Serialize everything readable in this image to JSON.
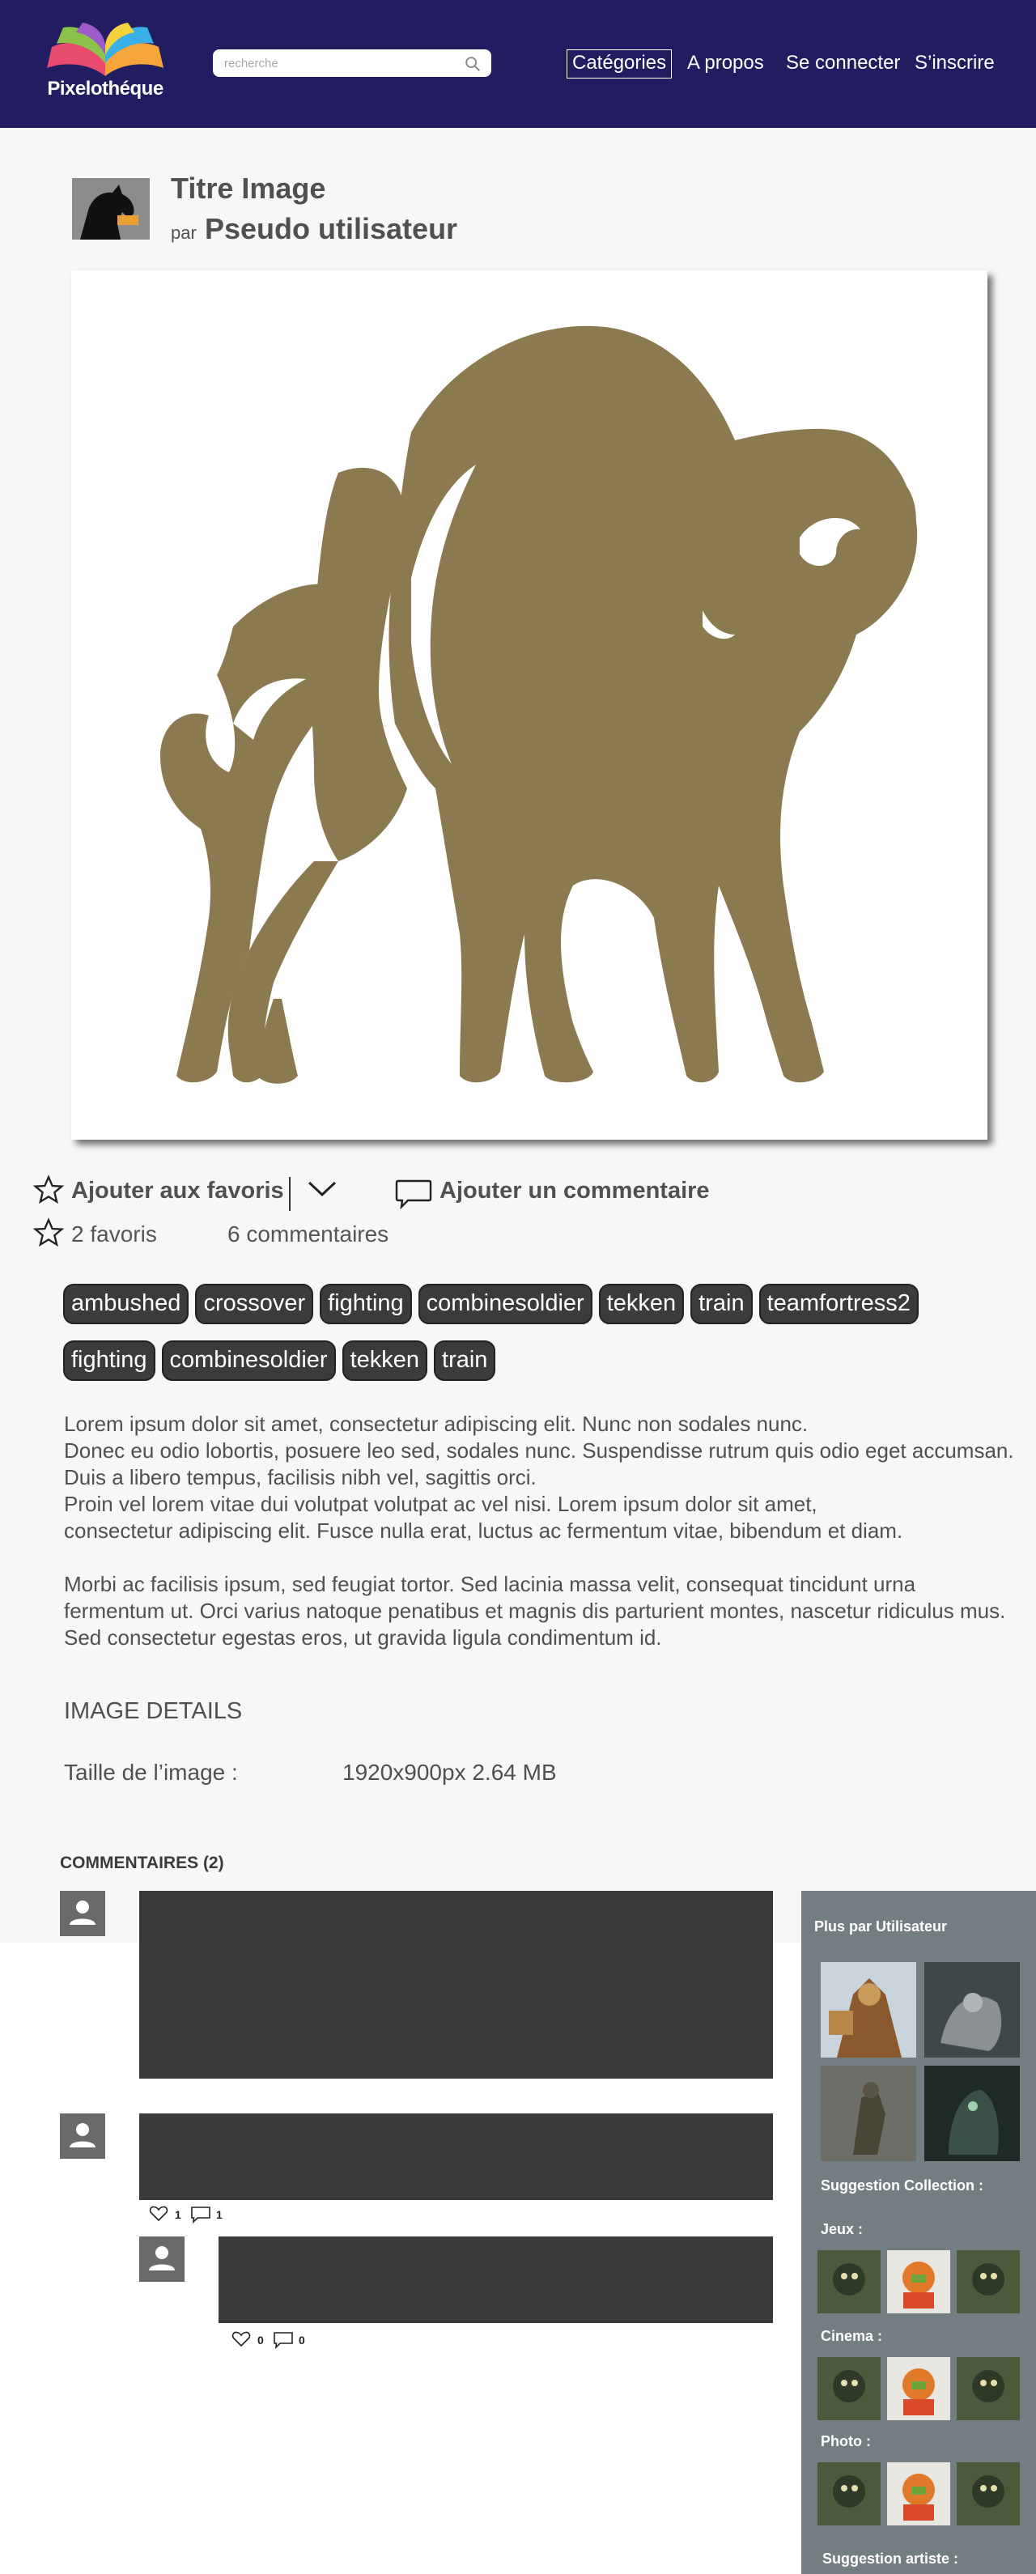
{
  "header": {
    "logo_text": "Pixelothéque",
    "search_placeholder": "recherche",
    "nav": {
      "categories": "Catégories",
      "about": "A propos",
      "login": "Se connecter",
      "signup": "S’inscrire"
    }
  },
  "image": {
    "title": "Titre Image",
    "by": "par",
    "author": "Pseudo utilisateur",
    "color": "#8b7a50"
  },
  "actions": {
    "add_favorite": "Ajouter aux favoris",
    "add_comment": "Ajouter un commentaire",
    "favorites_count": "2 favoris",
    "comments_count": "6 commentaires"
  },
  "tags": [
    "ambushed",
    "crossover",
    "fighting",
    "combinesoldier",
    "tekken",
    "train",
    "teamfortress2",
    "fighting",
    "combinesoldier",
    "tekken",
    "train"
  ],
  "description": "Lorem ipsum dolor sit amet, consectetur adipiscing elit. Nunc non sodales nunc.\n Donec eu odio lobortis, posuere leo sed, sodales nunc. Suspendisse rutrum quis odio eget accumsan.\nDuis a libero tempus, facilisis nibh vel, sagittis orci.\nProin vel lorem vitae dui volutpat volutpat ac vel nisi. Lorem ipsum dolor sit amet,\nconsectetur adipiscing elit. Fusce nulla erat, luctus ac fermentum vitae, bibendum et diam.\n\nMorbi ac facilisis ipsum, sed feugiat tortor. Sed lacinia massa velit, consequat tincidunt urna\nfermentum ut. Orci varius natoque penatibus et magnis dis parturient montes, nascetur ridiculus mus.\nSed consectetur egestas eros, ut gravida ligula condimentum id.",
  "details": {
    "title": "IMAGE DETAILS",
    "size_label": "Taille de l’image :",
    "size_value": "1920x900px 2.64 MB"
  },
  "comments": {
    "title": "COMMENTAIRES  (2)",
    "items": [
      {
        "likes": "1",
        "replies": "1"
      },
      {
        "likes": "0",
        "replies": "0"
      }
    ]
  },
  "sidebar": {
    "more_by_user": "Plus par Utilisateur",
    "suggestion_collection": "Suggestion Collection :",
    "games": "Jeux :",
    "cinema": "Cinema :",
    "photo": "Photo :",
    "suggestion_artist": "Suggestion artiste :"
  },
  "colors": {
    "header_bg": "#221d61",
    "page_bg": "#f6f7f6",
    "sidebar_bg": "#727e82",
    "tag_bg": "#3b3b3e",
    "comment_box": "#3a3a3c"
  }
}
